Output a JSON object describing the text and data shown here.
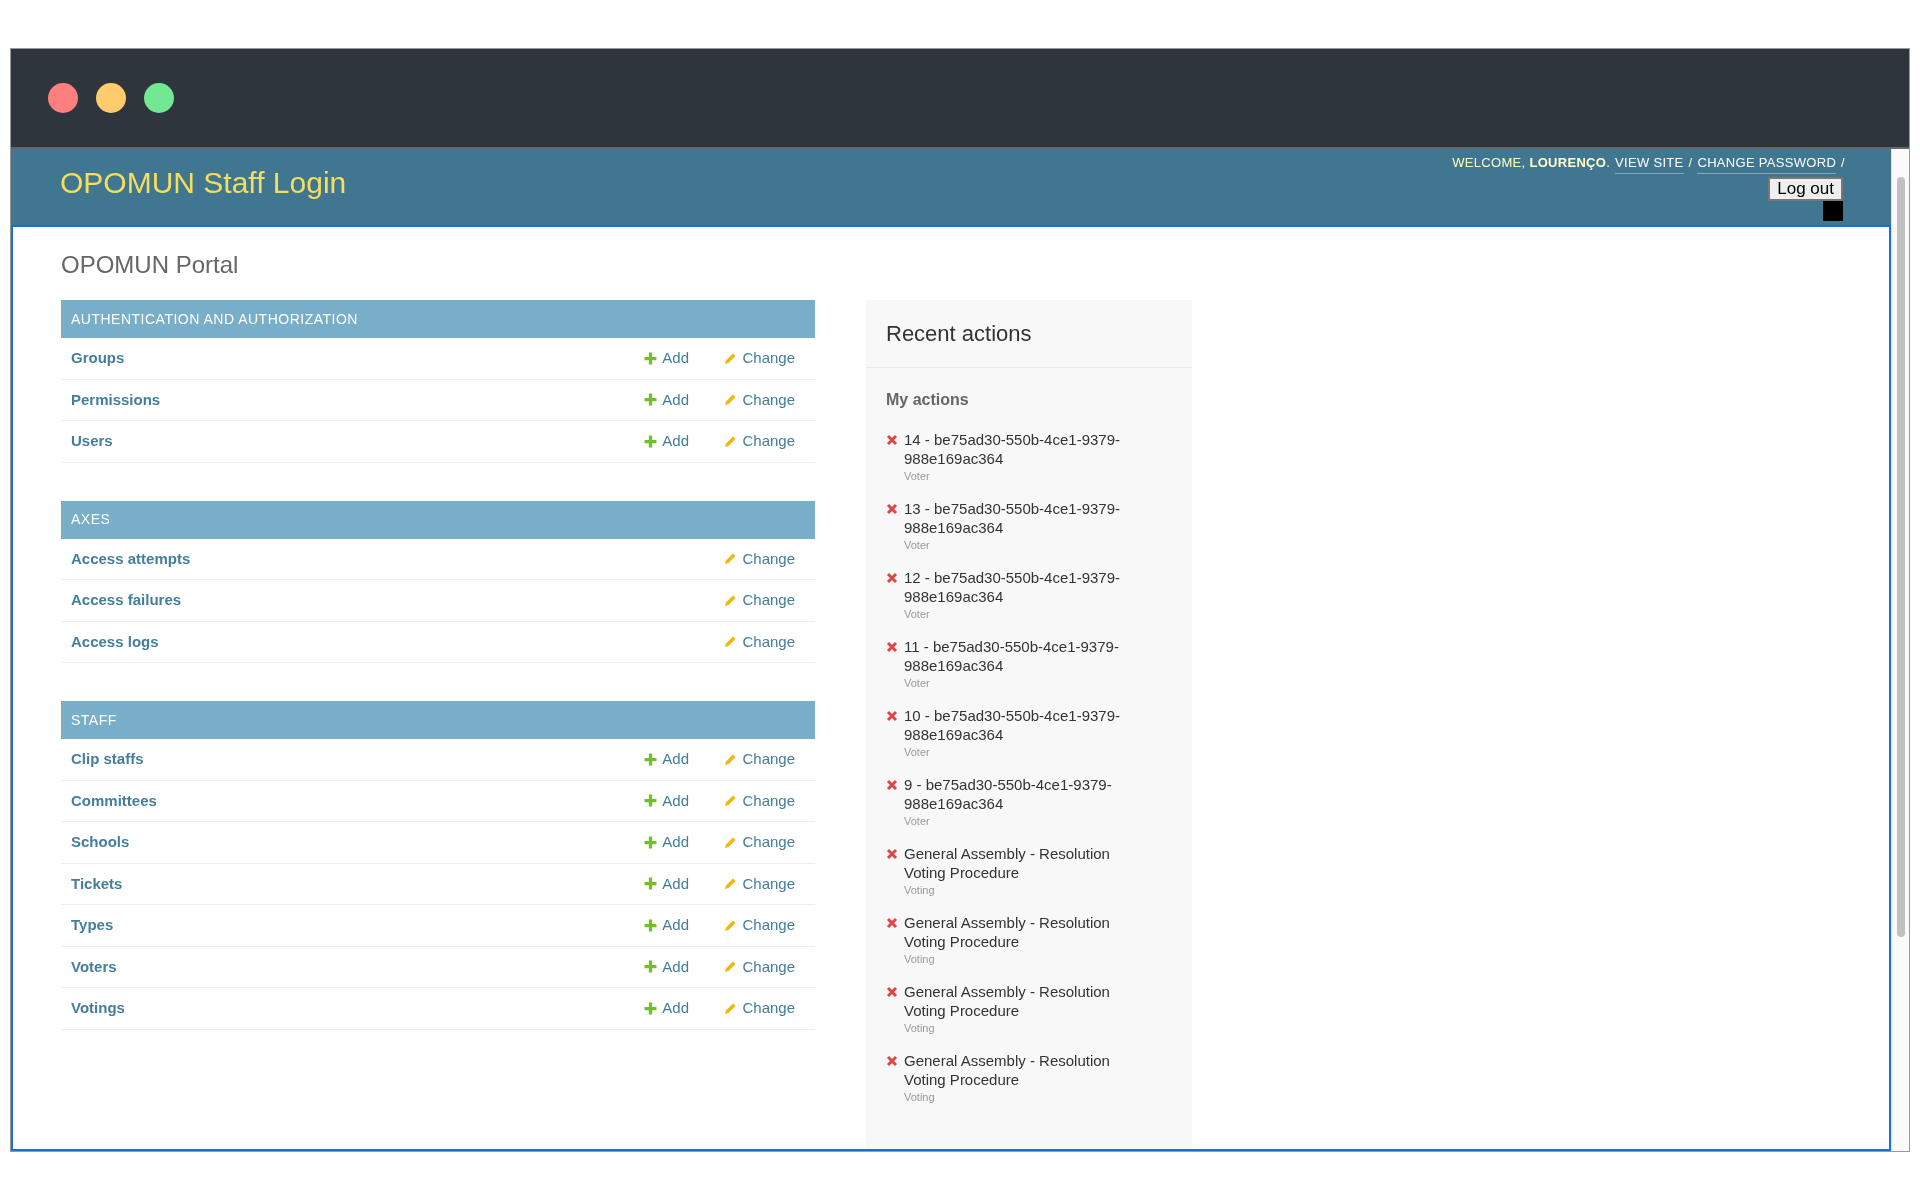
{
  "header": {
    "title": "OPOMUN Staff Login",
    "welcome": "WELCOME,",
    "user": "LOURENÇO",
    "user_suffix": ".",
    "links": [
      "VIEW SITE",
      "CHANGE PASSWORD"
    ],
    "separator": "/",
    "logout": "Log out"
  },
  "page_title": "OPOMUN Portal",
  "modules": [
    {
      "caption": "AUTHENTICATION AND AUTHORIZATION",
      "rows": [
        {
          "name": "Groups",
          "add": "Add",
          "change": "Change"
        },
        {
          "name": "Permissions",
          "add": "Add",
          "change": "Change"
        },
        {
          "name": "Users",
          "add": "Add",
          "change": "Change"
        }
      ]
    },
    {
      "caption": "AXES",
      "rows": [
        {
          "name": "Access attempts",
          "change": "Change"
        },
        {
          "name": "Access failures",
          "change": "Change"
        },
        {
          "name": "Access logs",
          "change": "Change"
        }
      ]
    },
    {
      "caption": "STAFF",
      "rows": [
        {
          "name": "Clip staffs",
          "add": "Add",
          "change": "Change"
        },
        {
          "name": "Committees",
          "add": "Add",
          "change": "Change"
        },
        {
          "name": "Schools",
          "add": "Add",
          "change": "Change"
        },
        {
          "name": "Tickets",
          "add": "Add",
          "change": "Change"
        },
        {
          "name": "Types",
          "add": "Add",
          "change": "Change"
        },
        {
          "name": "Voters",
          "add": "Add",
          "change": "Change"
        },
        {
          "name": "Votings",
          "add": "Add",
          "change": "Change"
        }
      ]
    }
  ],
  "recent": {
    "title": "Recent actions",
    "subtitle": "My actions",
    "items": [
      {
        "kind": "deletion",
        "text": "14 - be75ad30-550b-4ce1-9379-988e169ac364",
        "type": "Voter"
      },
      {
        "kind": "deletion",
        "text": "13 - be75ad30-550b-4ce1-9379-988e169ac364",
        "type": "Voter"
      },
      {
        "kind": "deletion",
        "text": "12 - be75ad30-550b-4ce1-9379-988e169ac364",
        "type": "Voter"
      },
      {
        "kind": "deletion",
        "text": "11 - be75ad30-550b-4ce1-9379-988e169ac364",
        "type": "Voter"
      },
      {
        "kind": "deletion",
        "text": "10 - be75ad30-550b-4ce1-9379-988e169ac364",
        "type": "Voter"
      },
      {
        "kind": "deletion",
        "text": "9 - be75ad30-550b-4ce1-9379-988e169ac364",
        "type": "Voter"
      },
      {
        "kind": "deletion",
        "text": "General Assembly - Resolution Voting Procedure",
        "type": "Voting"
      },
      {
        "kind": "deletion",
        "text": "General Assembly - Resolution Voting Procedure",
        "type": "Voting"
      },
      {
        "kind": "deletion",
        "text": "General Assembly - Resolution Voting Procedure",
        "type": "Voting"
      },
      {
        "kind": "deletion",
        "text": "General Assembly - Resolution Voting Procedure",
        "type": "Voting"
      }
    ]
  }
}
